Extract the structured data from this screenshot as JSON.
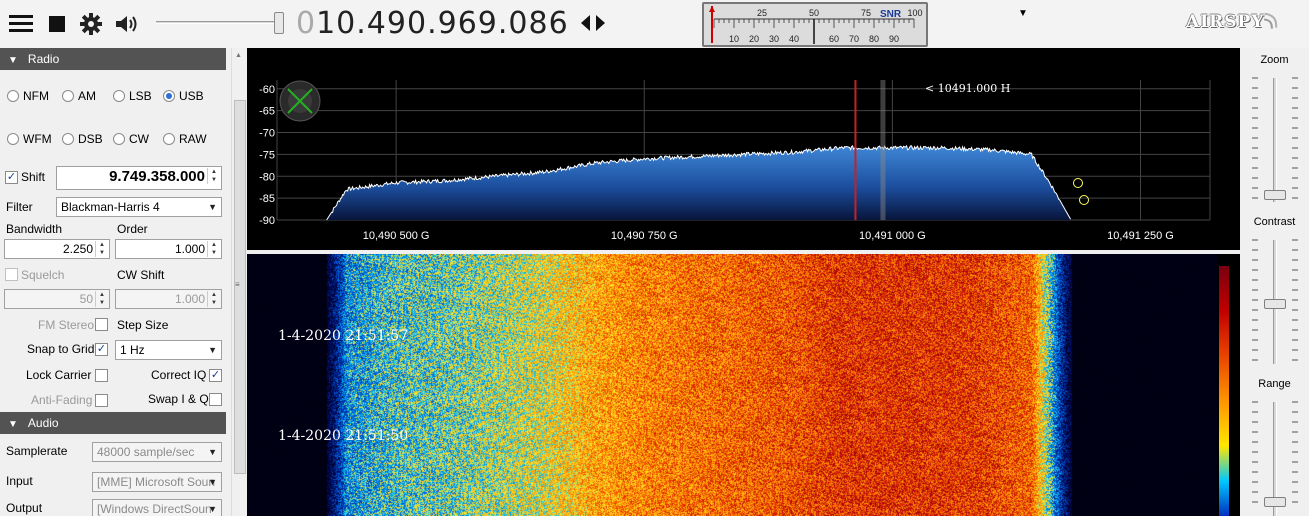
{
  "toolbar": {
    "frequency_prefix": "0",
    "frequency": "10.490.969.086",
    "icons": [
      "menu-icon",
      "stop-icon",
      "gear-icon",
      "speaker-icon",
      "left-right-arrows-icon",
      "dropdown-arrow-icon"
    ],
    "volume_level": 0.95,
    "logo": "AIRSPY"
  },
  "snr_meter": {
    "label": "SNR",
    "top_scale": [
      "25",
      "50",
      "75",
      "100"
    ],
    "bottom_scale": [
      "10",
      "20",
      "30",
      "40",
      "60",
      "70",
      "80",
      "90"
    ]
  },
  "radio": {
    "header": "Radio",
    "modes": [
      {
        "label": "NFM",
        "selected": false
      },
      {
        "label": "AM",
        "selected": false
      },
      {
        "label": "LSB",
        "selected": false
      },
      {
        "label": "USB",
        "selected": true
      },
      {
        "label": "WFM",
        "selected": false
      },
      {
        "label": "DSB",
        "selected": false
      },
      {
        "label": "CW",
        "selected": false
      },
      {
        "label": "RAW",
        "selected": false
      }
    ],
    "shift_label": "Shift",
    "shift_checked": true,
    "shift_value": "9.749.358.000",
    "filter_label": "Filter",
    "filter_value": "Blackman-Harris 4",
    "bandwidth_label": "Bandwidth",
    "bandwidth_value": "2.250",
    "order_label": "Order",
    "order_value": "1.000",
    "squelch_label": "Squelch",
    "squelch_value": "50",
    "cw_shift_label": "CW Shift",
    "cw_shift_value": "1.000",
    "fm_stereo_label": "FM Stereo",
    "step_size_label": "Step Size",
    "snap_label": "Snap to Grid",
    "snap_checked": true,
    "step_size_value": "1 Hz",
    "lock_carrier_label": "Lock Carrier",
    "correct_iq_label": "Correct IQ",
    "correct_iq_checked": true,
    "anti_fading_label": "Anti-Fading",
    "swap_iq_label": "Swap I & Q"
  },
  "audio": {
    "header": "Audio",
    "samplerate_label": "Samplerate",
    "samplerate_value": "48000 sample/sec",
    "input_label": "Input",
    "input_value": "[MME] Microsoft Soun",
    "output_label": "Output",
    "output_value": "[Windows DirectSoun"
  },
  "spectrum": {
    "y_ticks": [
      "-60",
      "-65",
      "-70",
      "-75",
      "-80",
      "-85",
      "-90"
    ],
    "x_ticks": [
      "10,490 500 G",
      "10,490 750 G",
      "10,491 000 G",
      "10,491 250 G"
    ],
    "cursor_label": "< 10491.000 H"
  },
  "waterfall": {
    "timestamps": [
      "1-4-2020 21:51:57",
      "1-4-2020 21:51:50"
    ]
  },
  "right_sliders": {
    "zoom_label": "Zoom",
    "zoom_level": 0.05,
    "contrast_label": "Contrast",
    "contrast_level": 0.5,
    "range_label": "Range",
    "range_level": 0.05
  },
  "chart_data": {
    "type": "area",
    "title": "",
    "xlabel": "",
    "ylabel": "",
    "x_unit": "GHz",
    "xlim": [
      10.49038,
      10.49132
    ],
    "ylim": [
      -90,
      -58
    ],
    "x_ticks": [
      10.4905,
      10.49075,
      10.491,
      10.49125
    ],
    "y_ticks": [
      -60,
      -65,
      -70,
      -75,
      -80,
      -85,
      -90
    ],
    "grid": true,
    "cursor_x": 10.49099,
    "series": [
      {
        "x": [
          10.49043,
          10.49045,
          10.4905,
          10.49055,
          10.4906,
          10.49065,
          10.4907,
          10.49075,
          10.4908,
          10.49085,
          10.4909,
          10.49095,
          10.491,
          10.49105,
          10.4911,
          10.49114,
          10.49116,
          10.49118
        ],
        "values": [
          -90,
          -83,
          -81.5,
          -81,
          -80,
          -79,
          -77,
          -76,
          -75.5,
          -75,
          -74.5,
          -73.5,
          -73.5,
          -73.5,
          -74,
          -75,
          -82,
          -90
        ]
      }
    ]
  }
}
